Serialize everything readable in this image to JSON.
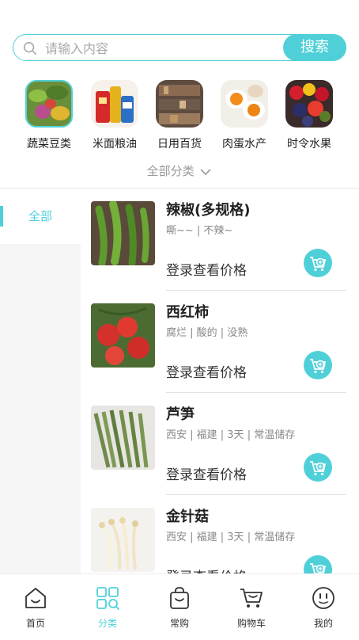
{
  "search": {
    "placeholder": "请输入内容",
    "button_label": "搜索"
  },
  "categories": [
    {
      "label": "蔬菜豆类"
    },
    {
      "label": "米面粮油"
    },
    {
      "label": "日用百货"
    },
    {
      "label": "肉蛋水产"
    },
    {
      "label": "时令水果"
    }
  ],
  "all_categories_label": "全部分类",
  "sidebar": {
    "active_label": "全部"
  },
  "products": [
    {
      "name": "辣椒(多规格)",
      "tags": "嘶~~ | 不辣~",
      "price_label": "登录查看价格"
    },
    {
      "name": "西红柿",
      "tags": "腐烂 | 酸的 | 没熟",
      "price_label": "登录查看价格"
    },
    {
      "name": "芦笋",
      "tags": "西安 | 福建 | 3天 | 常温储存",
      "price_label": "登录查看价格"
    },
    {
      "name": "金针菇",
      "tags": "西安 | 福建 | 3天 | 常温储存",
      "price_label": "登录查看价格"
    }
  ],
  "bottom_nav": [
    {
      "label": "首页",
      "icon": "home-icon"
    },
    {
      "label": "分类",
      "icon": "category-icon"
    },
    {
      "label": "常购",
      "icon": "shopping-bag-icon"
    },
    {
      "label": "购物车",
      "icon": "cart-icon"
    },
    {
      "label": "我的",
      "icon": "profile-icon"
    }
  ],
  "colors": {
    "accent": "#4fd0d8",
    "text": "#333333",
    "muted": "#999999"
  }
}
